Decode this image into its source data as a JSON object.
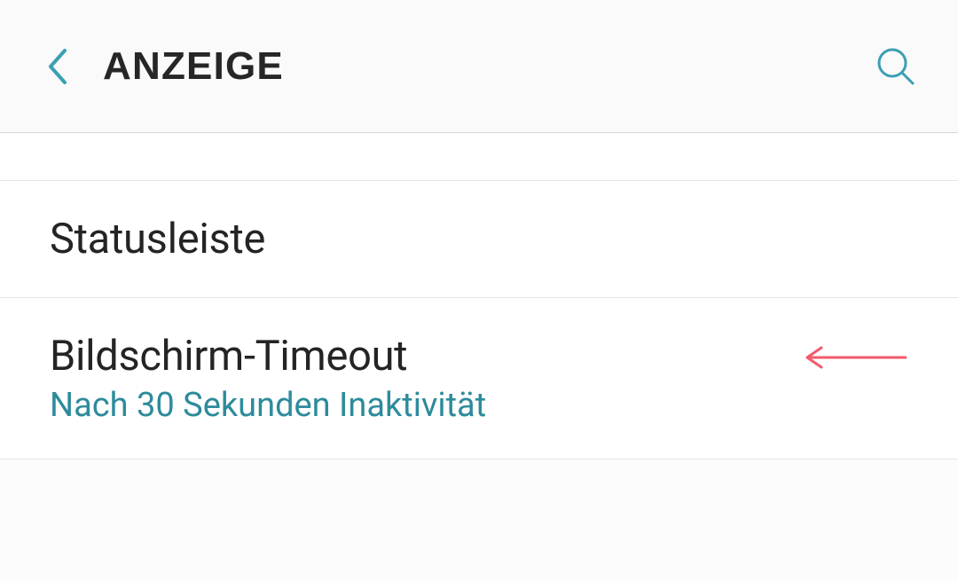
{
  "header": {
    "title": "ANZEIGE"
  },
  "items": {
    "statusbar": {
      "label": "Statusleiste"
    },
    "screenTimeout": {
      "label": "Bildschirm-Timeout",
      "subtitle": "Nach 30 Sekunden Inaktivität"
    }
  },
  "colors": {
    "accent": "#3aa0b2",
    "arrow": "#f35a6a"
  }
}
